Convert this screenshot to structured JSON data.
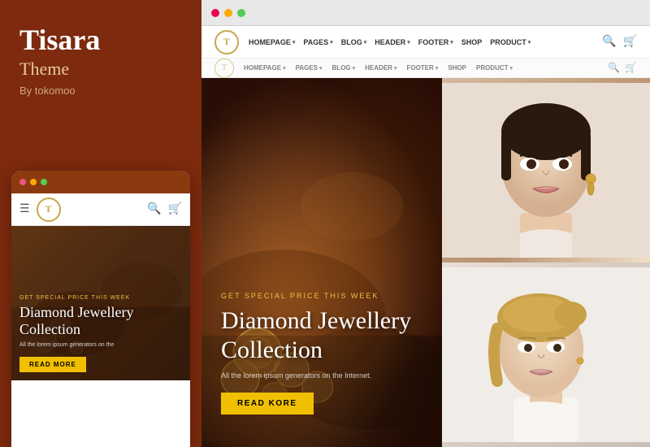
{
  "left_panel": {
    "brand_title": "Tisara",
    "brand_subtitle": "Theme",
    "brand_by": "By tokomoo"
  },
  "mobile_mockup": {
    "dots": [
      "red",
      "yellow",
      "green"
    ],
    "logo_letter": "T",
    "hero_small": "GET SPECIAL PRICE THIS WEEK",
    "hero_title": "Diamond Jewellery Collection",
    "hero_desc": "All the lorem ipsum generators on the",
    "read_more_btn": "READ MORE"
  },
  "browser": {
    "dots": [
      "red",
      "yellow",
      "green"
    ],
    "nav": {
      "logo_letter": "T",
      "items": [
        {
          "label": "HOMEPAGE",
          "has_caret": true
        },
        {
          "label": "PAGES",
          "has_caret": true
        },
        {
          "label": "BLOG",
          "has_caret": true
        },
        {
          "label": "HEADER",
          "has_caret": true
        },
        {
          "label": "FOOTER",
          "has_caret": true
        },
        {
          "label": "SHOP",
          "has_caret": false
        },
        {
          "label": "PRODUCT",
          "has_caret": true
        }
      ],
      "nav2_items": [
        "HOMEPAGE ▾",
        "PAGES ▾",
        "BLOG ▾",
        "HEADER ▾",
        "FOOTER ▾",
        "SHOP",
        "PRODUCT ▾"
      ]
    },
    "hero": {
      "small_text": "GET SPECIAL PRICE THIS WEEK",
      "title": "Diamond Jewellery Collection",
      "desc": "All the lorem ipsum generators on the Internet.",
      "btn_label": "Read KORE"
    }
  }
}
